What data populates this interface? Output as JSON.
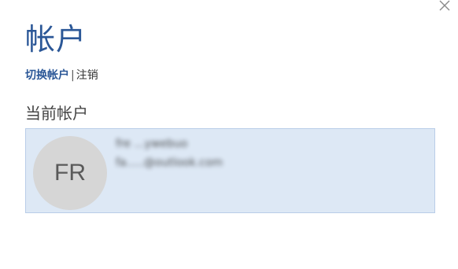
{
  "header": {
    "title": "帐户",
    "close_icon": "close-icon"
  },
  "links": {
    "switch_account": "切换帐户",
    "separator": "|",
    "sign_out": "注销"
  },
  "current_account": {
    "heading": "当前帐户",
    "avatar_initials": "FR",
    "name": "fre  ...ywebuo",
    "email": "fa.....@outlook.com"
  },
  "colors": {
    "accent": "#2b5797",
    "card_background": "#dde8f5",
    "card_border": "#b9cde8",
    "avatar_background": "#d6d6d6"
  }
}
